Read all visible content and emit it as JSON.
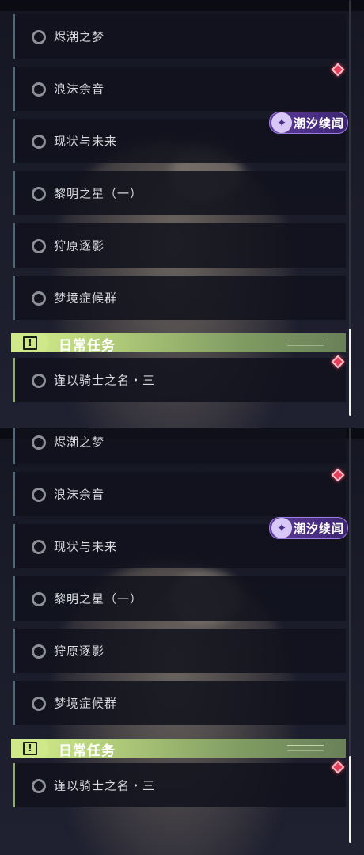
{
  "views": [
    {
      "tasks": [
        {
          "label": "烬潮之梦"
        },
        {
          "label": "浪沫余音"
        },
        {
          "label": "现状与未来"
        },
        {
          "label": "黎明之星（一）"
        },
        {
          "label": "狩原逐影"
        },
        {
          "label": "梦境症候群"
        }
      ],
      "badge": {
        "label": "潮汐续闻",
        "icon": "tide-star-icon"
      },
      "section": {
        "title": "日常任务",
        "icon": "exclamation-icon"
      },
      "daily_tasks": [
        {
          "label": "谨以骑士之名・三"
        }
      ]
    },
    {
      "tasks": [
        {
          "label": "烬潮之梦"
        },
        {
          "label": "浪沫余音"
        },
        {
          "label": "现状与未来"
        },
        {
          "label": "黎明之星（一）"
        },
        {
          "label": "狩原逐影"
        },
        {
          "label": "梦境症候群"
        }
      ],
      "badge": {
        "label": "潮汐续闻",
        "icon": "tide-star-icon"
      },
      "section": {
        "title": "日常任务",
        "icon": "exclamation-icon"
      },
      "daily_tasks": [
        {
          "label": "谨以骑士之名・三"
        }
      ]
    }
  ],
  "colors": {
    "accent_daily": "#cfe88a",
    "badge_purple": "#5d3b9a",
    "notify_red": "#e0405a",
    "task_bar": "#4f6878"
  }
}
